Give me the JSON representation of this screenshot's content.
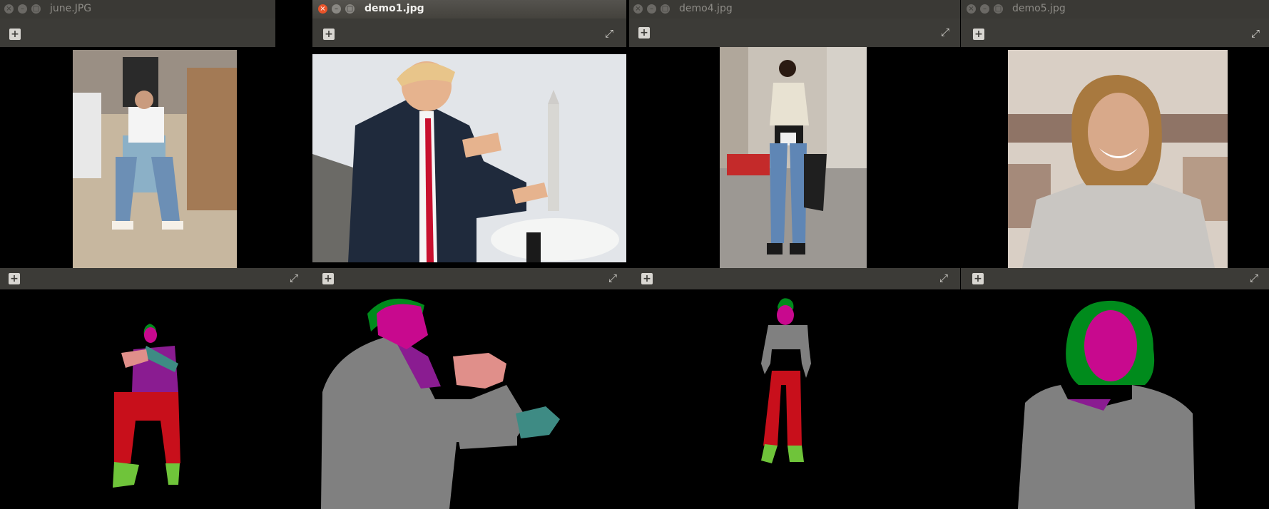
{
  "windows": [
    {
      "title": "june.JPG"
    },
    {
      "title": "demo1.jpg"
    },
    {
      "title": "demo4.jpg"
    },
    {
      "title": "demo5.jpg"
    }
  ],
  "icons": {
    "add": "add-image-icon",
    "fullscreen": "fullscreen-icon",
    "close": "close-icon",
    "minimize": "minimize-icon",
    "maximize": "maximize-icon"
  },
  "segmentation_colors": {
    "hair": "#008b1c",
    "face": "#c8098e",
    "upper_clothes": "#8a1c91",
    "coat": "#808080",
    "pants": "#c80f1b",
    "arms": "#e08f8a",
    "right_arm": "#3e8b84",
    "shoes": "#6fc43a",
    "neck": "#9b8ea0"
  },
  "glyphs": {
    "add": "+",
    "fullscreen": "⤢",
    "close": "×",
    "minimize": "–",
    "maximize": "□"
  }
}
